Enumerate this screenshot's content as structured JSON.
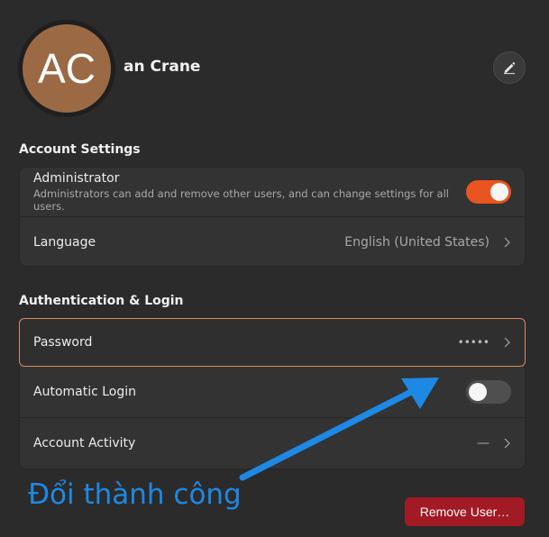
{
  "header": {
    "avatar_initials": "AC",
    "user_name": "an Crane",
    "edit_icon": "pencil-icon"
  },
  "account_settings": {
    "title": "Account Settings",
    "administrator": {
      "label": "Administrator",
      "description": "Administrators can add and remove other users, and can change settings for all users.",
      "enabled": true
    },
    "language": {
      "label": "Language",
      "value": "English (United States)"
    }
  },
  "authentication": {
    "title": "Authentication & Login",
    "password": {
      "label": "Password",
      "value": "•••••"
    },
    "automatic_login": {
      "label": "Automatic Login",
      "enabled": false
    },
    "account_activity": {
      "label": "Account Activity",
      "value": "—"
    }
  },
  "remove_user_label": "Remove User…",
  "annotation": {
    "text": "Đổi thành công",
    "color": "#1e88e5"
  },
  "colors": {
    "accent": "#e95420",
    "destructive": "#a11a24",
    "focus_ring": "#d98a62"
  }
}
